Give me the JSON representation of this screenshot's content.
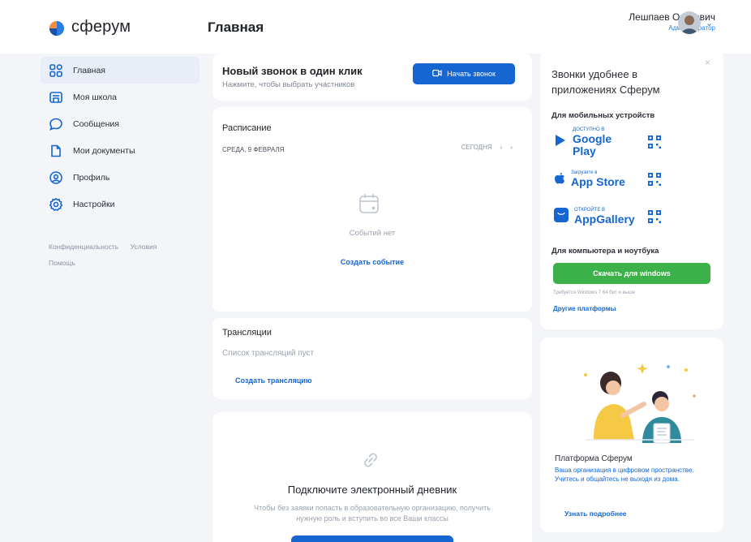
{
  "header": {
    "logo_text": "сферум",
    "page_title": "Главная",
    "user_name": "Лешпаев Олегович",
    "user_role": "Администратор"
  },
  "sidebar": {
    "items": [
      {
        "label": "Главная",
        "icon": "home-grid-icon",
        "active": true
      },
      {
        "label": "Моя школа",
        "icon": "school-icon"
      },
      {
        "label": "Сообщения",
        "icon": "chat-icon"
      },
      {
        "label": "Мои документы",
        "icon": "documents-icon"
      },
      {
        "label": "Профиль",
        "icon": "profile-icon"
      },
      {
        "label": "Настройки",
        "icon": "settings-icon"
      }
    ],
    "privacy": "Конфиденциальность",
    "terms": "Условия",
    "help": "Помощь"
  },
  "call": {
    "title": "Новый звонок в один клик",
    "subtitle": "Нажмите, чтобы выбрать участников",
    "button": "Начать звонок"
  },
  "schedule": {
    "title": "Расписание",
    "date": "СРЕДА, 9 ФЕВРАЛЯ",
    "today": "СЕГОДНЯ",
    "empty": "Событий нет",
    "create": "Создать событие"
  },
  "streams": {
    "title": "Трансляции",
    "empty": "Список трансляций пуст",
    "create": "Создать трансляцию"
  },
  "diary": {
    "title": "Подключите электронный дневник",
    "text": "Чтобы без заявки попасть в образовательную организацию, получить нужную роль и вступить во все Ваши классы"
  },
  "apps": {
    "title": "Звонки удобнее в приложениях Сферум",
    "mobile_label": "Для мобильных устройств",
    "google_small": "ДОСТУПНО В",
    "google_big": "Google Play",
    "apple_small": "Загрузите в",
    "apple_big": "App Store",
    "huawei_small": "ОТКРОЙТЕ В",
    "huawei_big": "AppGallery",
    "pc_label": "Для компьютера и ноутбука",
    "download": "Скачать для windows",
    "requirement": "Требуется Windows 7 64 бит и выше",
    "other": "Другие платформы",
    "close": "×"
  },
  "platform": {
    "title": "Платформа Сферум",
    "text": "Ваша организация в цифровом пространстве. Учитесь и общайтесь не выходя из дома.",
    "more": "Узнать подробнее"
  },
  "colors": {
    "accent": "#1566d1",
    "download": "#3cb14a",
    "background": "#f3f5f9"
  }
}
